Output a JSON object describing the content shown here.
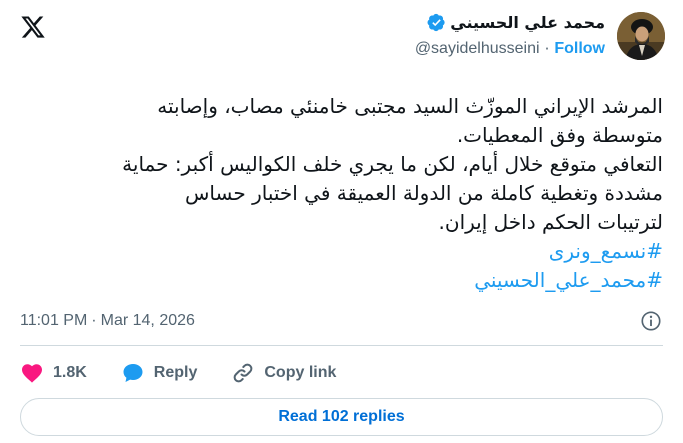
{
  "author": {
    "display_name": "محمد علي الحسيني",
    "handle": "@sayidelhusseini",
    "separator": "·",
    "follow_label": "Follow"
  },
  "tweet": {
    "lines": [
      "المرشد الإيراني الموزّث السيد مجتبى خامنئي مصاب، وإصابته",
      "متوسطة وفق المعطيات.",
      "التعافي متوقع خلال أيام، لكن ما يجري خلف الكواليس أكبر: حماية",
      "مشددة وتغطية كاملة من الدولة العميقة في اختبار حساس",
      "لترتيبات الحكم داخل إيران."
    ],
    "hashtags": [
      "#نسمع_ونرى",
      "#محمد_علي_الحسيني"
    ]
  },
  "meta": {
    "time": "11:01 PM",
    "separator": "·",
    "date": "Mar 14, 2026"
  },
  "actions": {
    "likes": "1.8K",
    "reply_label": "Reply",
    "copy_link_label": "Copy link"
  },
  "read_replies_label": "Read 102 replies",
  "icons": {
    "logo": "x-logo-icon",
    "verified": "verified-badge-icon",
    "like": "heart-icon",
    "reply": "speech-bubble-icon",
    "copy": "link-icon",
    "info": "info-icon"
  },
  "colors": {
    "accent": "#1d9bf0",
    "like": "#f91880",
    "muted": "#536471",
    "text": "#0f1419",
    "border": "#cfd9de"
  }
}
